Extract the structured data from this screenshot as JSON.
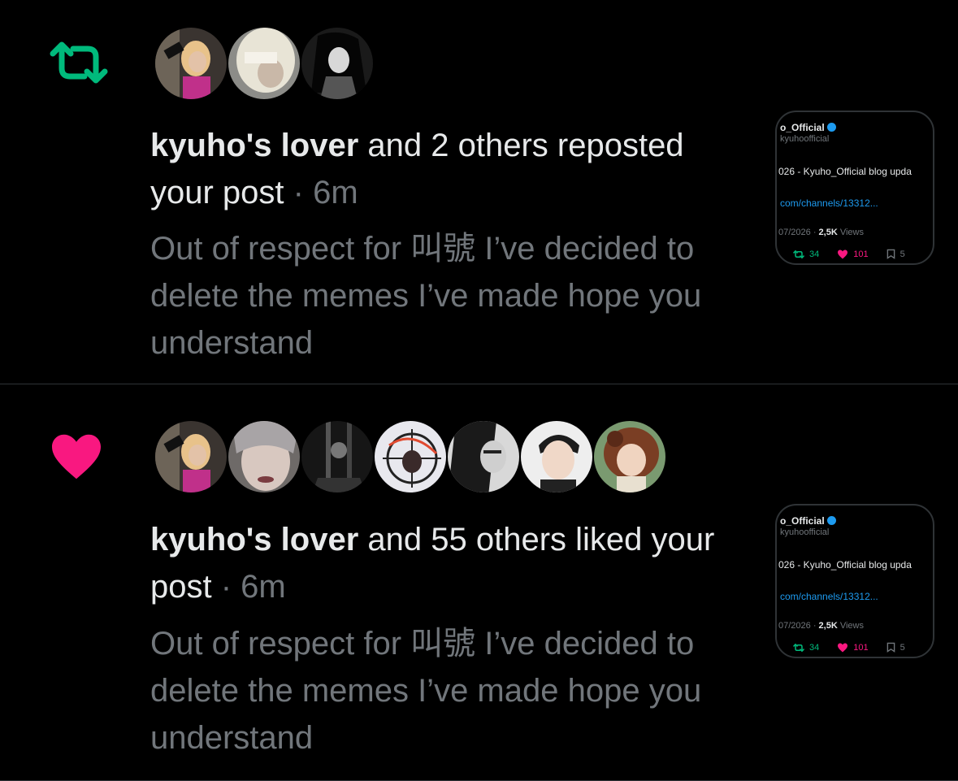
{
  "notifications": [
    {
      "type_icon": "repost-icon",
      "accent": "#00ba7c",
      "name": "kyuho's lover",
      "action_text": " and 2 others reposted your post",
      "dot": " · ",
      "time": "6m",
      "snippet": "Out of respect for 叫號 I’ve decided to delete the memes I’ve made hope you understand",
      "avatars": [
        "avatar-1",
        "avatar-2",
        "avatar-3"
      ],
      "thumb": {
        "name": "o_Official",
        "handle": "kyuhoofficial",
        "text": "026 - Kyuho_Official blog upda",
        "link": "com/channels/13312...",
        "date": "07/2026 · ",
        "views_count": "2,5K",
        "views_label": " Views",
        "reposts": "34",
        "likes": "101",
        "bookmark": "5"
      }
    },
    {
      "type_icon": "heart-icon",
      "accent": "#f91880",
      "name": "kyuho's lover",
      "action_text": " and 55 others liked your post",
      "dot": " · ",
      "time": "6m",
      "snippet": "Out of respect for 叫號 I’ve decided to delete the memes I’ve made hope you understand",
      "avatars": [
        "avatar-1",
        "avatar-2",
        "avatar-3",
        "avatar-4",
        "avatar-5",
        "avatar-6",
        "avatar-7"
      ],
      "thumb": {
        "name": "o_Official",
        "handle": "kyuhoofficial",
        "text": "026 - Kyuho_Official blog upda",
        "link": "com/channels/13312...",
        "date": "07/2026 · ",
        "views_count": "2,5K",
        "views_label": " Views",
        "reposts": "34",
        "likes": "101",
        "bookmark": "5"
      }
    }
  ]
}
